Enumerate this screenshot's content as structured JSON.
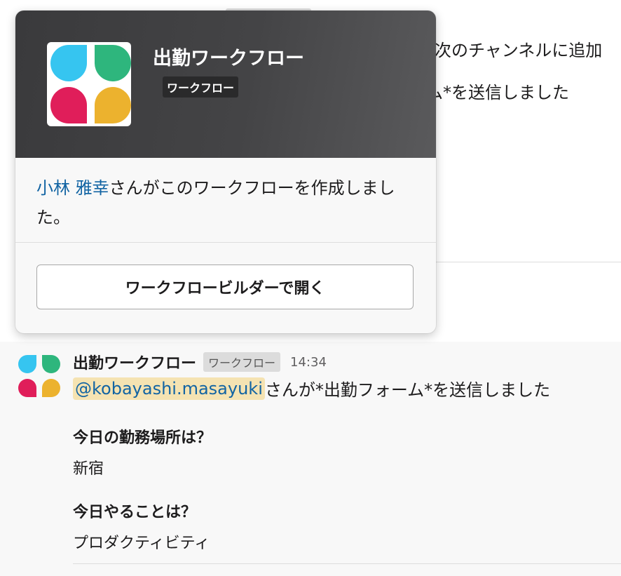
{
  "background": {
    "channel_fragment": "次のチャンネルに追加",
    "submit_fragment": "ム*を送信しました"
  },
  "popover": {
    "title": "出勤ワークフロー",
    "badge": "ワークフロー",
    "creator_name": "小林 雅幸",
    "creator_suffix": "さんがこのワークフローを作成しました。",
    "open_button": "ワークフロービルダーで開く"
  },
  "message": {
    "sender": "出勤ワークフロー",
    "badge": "ワークフロー",
    "time": "14:34",
    "mention": "@kobayashi.masayuki",
    "body_suffix": "さんが*出勤フォーム*を送信しました",
    "fields": [
      {
        "label": "今日の勤務場所は？",
        "value": "新宿"
      },
      {
        "label": "今日やることは？",
        "value": "プロダクティビティ"
      }
    ]
  },
  "colors": {
    "icon_blue": "#36c5f0",
    "icon_green": "#2eb67d",
    "icon_red": "#e01e5a",
    "icon_yellow": "#ecb22e",
    "link": "#1264a3",
    "mention_bg": "#f5e3b2"
  },
  "icons": {
    "workflow": "workflow-app-icon"
  }
}
